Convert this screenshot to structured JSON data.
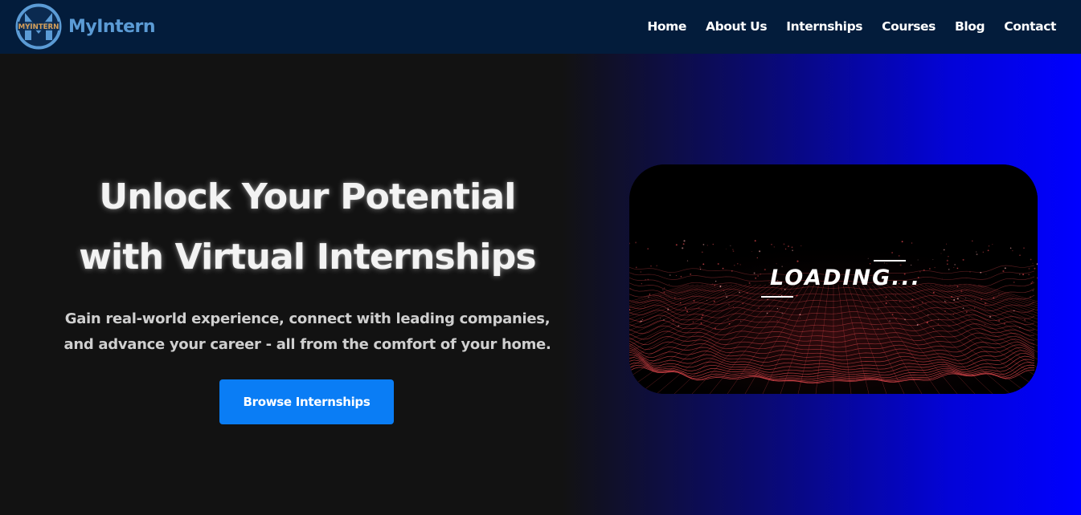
{
  "brand": {
    "logo_text": "MYINTERN",
    "name": "MyIntern"
  },
  "nav": {
    "items": [
      {
        "label": "Home"
      },
      {
        "label": "About Us"
      },
      {
        "label": "Internships"
      },
      {
        "label": "Courses"
      },
      {
        "label": "Blog"
      },
      {
        "label": "Contact"
      }
    ]
  },
  "hero": {
    "title_line1": "Unlock Your Potential",
    "title_line2": "with Virtual Internships",
    "subtitle_line1": "Gain real-world experience, connect with leading companies,",
    "subtitle_line2": "and advance your career - all from the comfort of your home.",
    "cta_label": "Browse Internships"
  },
  "video": {
    "loading_text": "LOADING..."
  },
  "colors": {
    "navbar_bg": "#031c3b",
    "brand_text": "#5b9bd5",
    "cta_bg": "#0a7df5",
    "hero_bg_left": "#121212",
    "hero_bg_right": "#0000ff",
    "wave_color": "#e0474c"
  }
}
